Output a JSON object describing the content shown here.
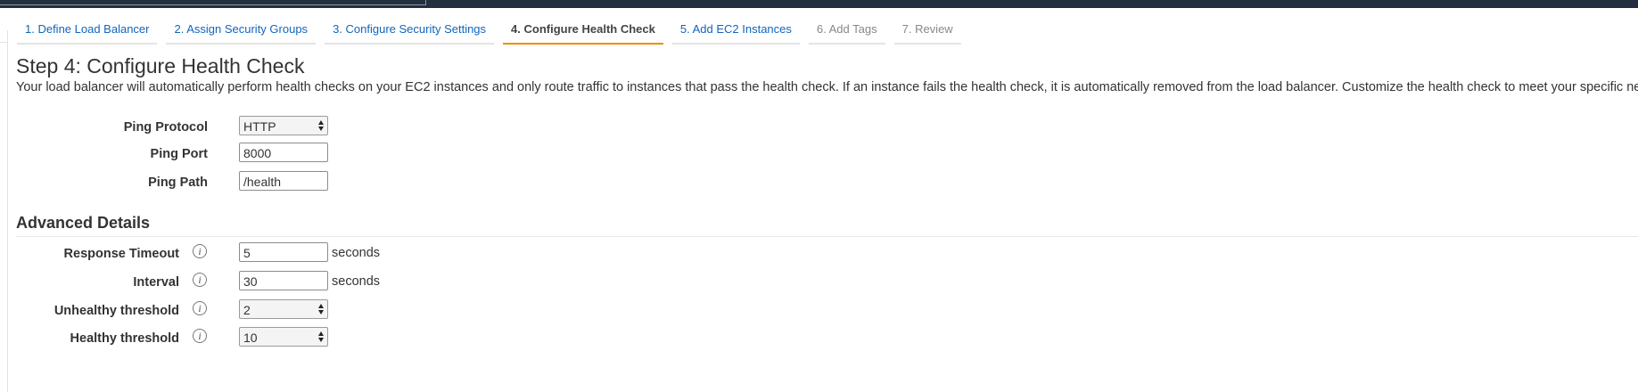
{
  "wizard": {
    "tabs": [
      {
        "label": "1. Define Load Balancer",
        "state": "link"
      },
      {
        "label": "2. Assign Security Groups",
        "state": "link"
      },
      {
        "label": "3. Configure Security Settings",
        "state": "link"
      },
      {
        "label": "4. Configure Health Check",
        "state": "active"
      },
      {
        "label": "5. Add EC2 Instances",
        "state": "link"
      },
      {
        "label": "6. Add Tags",
        "state": "disabled"
      },
      {
        "label": "7. Review",
        "state": "disabled"
      }
    ]
  },
  "step": {
    "title": "Step 4: Configure Health Check",
    "description": "Your load balancer will automatically perform health checks on your EC2 instances and only route traffic to instances that pass the health check. If an instance fails the health check, it is automatically removed from the load balancer. Customize the health check to meet your specific needs."
  },
  "health_check": {
    "ping_protocol": {
      "label": "Ping Protocol",
      "value": "HTTP"
    },
    "ping_port": {
      "label": "Ping Port",
      "value": "8000"
    },
    "ping_path": {
      "label": "Ping Path",
      "value": "/health"
    }
  },
  "advanced": {
    "title": "Advanced Details",
    "response_timeout": {
      "label": "Response Timeout",
      "value": "5",
      "unit": "seconds"
    },
    "interval": {
      "label": "Interval",
      "value": "30",
      "unit": "seconds"
    },
    "unhealthy_threshold": {
      "label": "Unhealthy threshold",
      "value": "2"
    },
    "healthy_threshold": {
      "label": "Healthy threshold",
      "value": "10"
    },
    "info_glyph": "i"
  },
  "colors": {
    "link": "#1166bb",
    "active_underline": "#f08c00",
    "topbar": "#232f3e"
  }
}
